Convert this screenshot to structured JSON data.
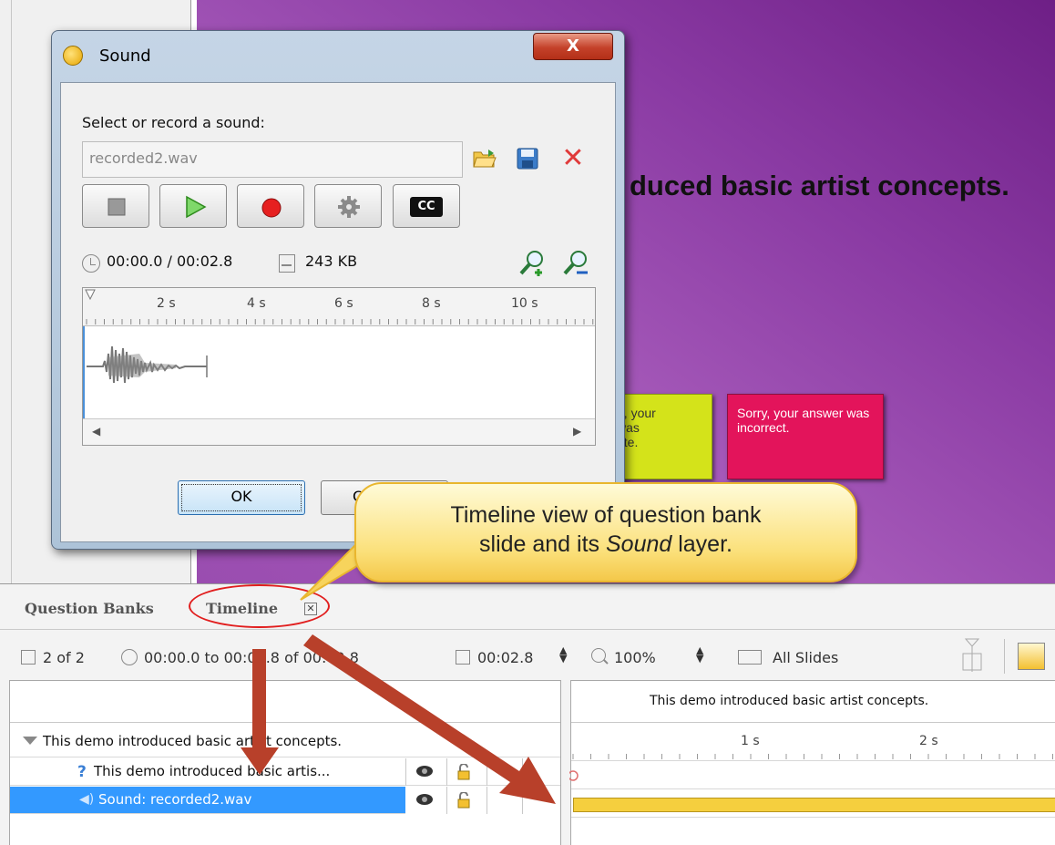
{
  "slide": {
    "heading": "duced basic artist concepts.",
    "feedback_yellow": "n, your\nwas\nete.",
    "feedback_red": "Sorry, your answer was incorrect."
  },
  "sound_dialog": {
    "title": "Sound",
    "close_label": "X",
    "select_label": "Select or record a sound:",
    "file_name": "recorded2.wav",
    "cc_label": "CC",
    "time": "00:00.0 / 00:02.8",
    "size": "243 KB",
    "ruler_labels": [
      "2 s",
      "4 s",
      "6 s",
      "8 s",
      "10 s"
    ],
    "ok_label": "OK",
    "cancel_label": "C"
  },
  "callout": {
    "line1": "Timeline view of question bank",
    "line2_pre": "slide and its ",
    "line2_italic": "Sound",
    "line2_post": " layer."
  },
  "bottom": {
    "tab_question_banks": "Question Banks",
    "tab_timeline": "Timeline",
    "toolbar": {
      "slide_count": "2 of 2",
      "time_range": "00:00.0 to 00:02.8 of 00:02.8",
      "duration": "00:02.8",
      "zoom": "100%",
      "all_slides": "All Slides"
    },
    "timeline_header": "This demo introduced basic artist concepts.",
    "timeline_ruler": [
      "1 s",
      "2 s"
    ],
    "rows": {
      "group": "This demo introduced basic artist concepts.",
      "question": "This demo introduced basic artis...",
      "sound": "Sound: recorded2.wav"
    }
  },
  "colors": {
    "slide_purple": "#8a3aa3",
    "callout_yellow": "#fbe07a",
    "selection_blue": "#3399ff",
    "arrow_red": "#b8402a",
    "sound_bar": "#f5cf3e"
  }
}
